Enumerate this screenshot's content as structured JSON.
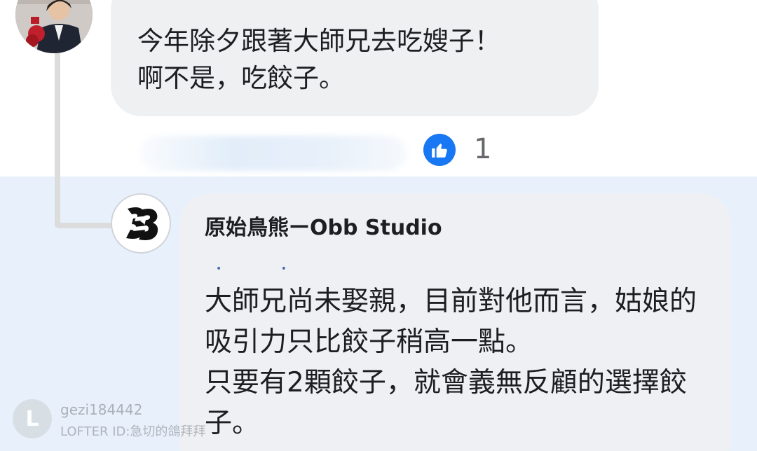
{
  "parent_comment": {
    "text": "今年除夕跟著大師兄去吃嫂子！\n啊不是，吃餃子。",
    "reactions": {
      "icon": "like-icon",
      "count": "1",
      "color": "#1877f2"
    }
  },
  "reply": {
    "author": "原始鳥熊ーObb Studio",
    "text": "大師兄尚未娶親，目前對他而言，姑娘的吸引力只比餃子稍高一點。\n只要有2顆餃子，就會義無反顧的選擇餃子。"
  },
  "watermark": {
    "username": "gezi184442",
    "lofter_id": "LOFTER ID:急切的鴿拜拜"
  },
  "colors": {
    "accent": "#1877f2",
    "reply_highlight": "#e8f1fb",
    "bubble": "#eff0f2",
    "text": "#1c1e21",
    "secondary_text": "#65676b"
  }
}
